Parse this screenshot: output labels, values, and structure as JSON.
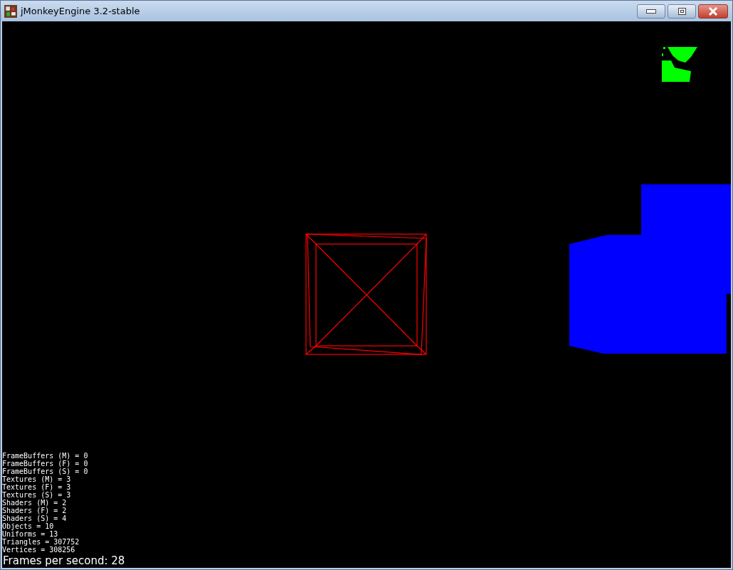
{
  "window": {
    "title": "jMonkeyEngine 3.2-stable"
  },
  "stats": [
    "FrameBuffers (M) = 0",
    "FrameBuffers (F) = 0",
    "FrameBuffers (S) = 0",
    "Textures (M) = 3",
    "Textures (F) = 3",
    "Textures (S) = 3",
    "Shaders (M) = 2",
    "Shaders (F) = 2",
    "Shaders (S) = 4",
    "Objects = 10",
    "Uniforms = 13",
    "Triangles = 307752",
    "Vertices = 308256"
  ],
  "fps": "Frames per second: 28"
}
